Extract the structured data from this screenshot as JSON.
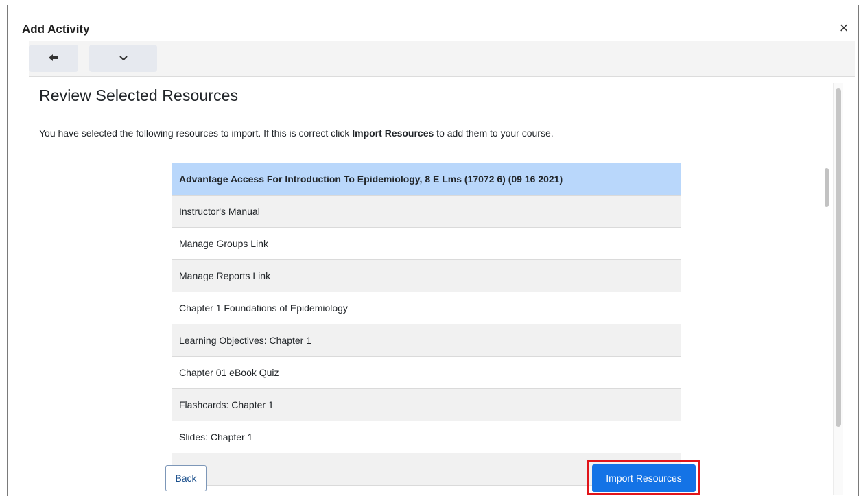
{
  "dialog": {
    "title": "Add Activity",
    "close_glyph": "×"
  },
  "toolbar": {
    "back_icon": "arrow-left-icon",
    "menu_icon": "chevron-down-icon"
  },
  "main": {
    "heading": "Review Selected Resources",
    "intro_before": "You have selected the following resources to import. If this is correct click ",
    "intro_bold": "Import Resources",
    "intro_after": " to add them to your course."
  },
  "resources": {
    "header": "Advantage Access For Introduction To Epidemiology, 8 E Lms (17072 6) (09 16 2021)",
    "items": [
      "Instructor's Manual",
      "Manage Groups Link",
      "Manage Reports Link",
      "Chapter 1 Foundations of Epidemiology",
      "Learning Objectives: Chapter 1",
      "Chapter 01 eBook Quiz",
      "Flashcards: Chapter 1",
      "Slides: Chapter 1"
    ]
  },
  "footer": {
    "back_label": "Back",
    "import_label": "Import Resources"
  },
  "colors": {
    "header_row": "#b9d7fb",
    "primary_button": "#1473e6",
    "highlight_border": "#e1151a"
  }
}
